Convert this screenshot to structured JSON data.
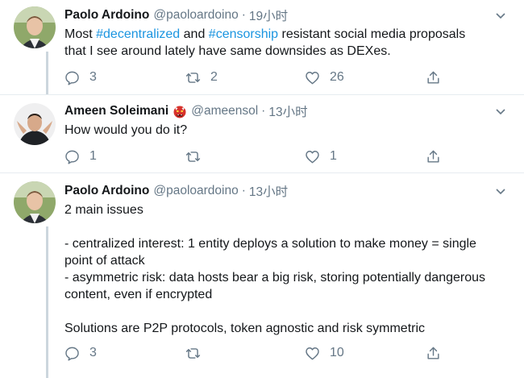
{
  "tweets": [
    {
      "name": "Paolo Ardoino",
      "handle": "@paoloardoino",
      "separator": "·",
      "time": "19小时",
      "text_parts": [
        {
          "text": "Most ",
          "hashtag": false
        },
        {
          "text": "#decentralized",
          "hashtag": true
        },
        {
          "text": " and ",
          "hashtag": false
        },
        {
          "text": "#censorship",
          "hashtag": true
        },
        {
          "text": " resistant social media proposals\nthat I see around lately have same downsides as DEXes.",
          "hashtag": false
        }
      ],
      "replies": "3",
      "retweets": "2",
      "likes": "26"
    },
    {
      "name": "Ameen Soleimani",
      "emoji": "ogre-face-emoji",
      "handle": "@ameensol",
      "separator": "·",
      "time": "13小时",
      "text_parts": [
        {
          "text": "How would you do it?",
          "hashtag": false
        }
      ],
      "replies": "1",
      "retweets": "",
      "likes": "1"
    },
    {
      "name": "Paolo Ardoino",
      "handle": "@paoloardoino",
      "separator": "·",
      "time": "13小时",
      "text_parts": [
        {
          "text": "2 main issues\n\n- centralized interest: 1 entity deploys a solution to make money = single\npoint of attack\n- asymmetric risk: data hosts bear a big risk, storing potentially dangerous\ncontent, even if encrypted\n\nSolutions are P2P protocols, token agnostic and risk symmetric",
          "hashtag": false
        }
      ],
      "replies": "3",
      "retweets": "",
      "likes": "10"
    }
  ],
  "colors": {
    "text": "#14171a",
    "secondary": "#657786",
    "hashtag": "#1b95e0",
    "thread_line": "#ccd6dd",
    "divider": "#e6ecf0"
  },
  "icons": {
    "reply": "reply-icon",
    "retweet": "retweet-icon",
    "like": "heart-icon",
    "share": "share-icon",
    "menu": "chevron-down-icon"
  }
}
